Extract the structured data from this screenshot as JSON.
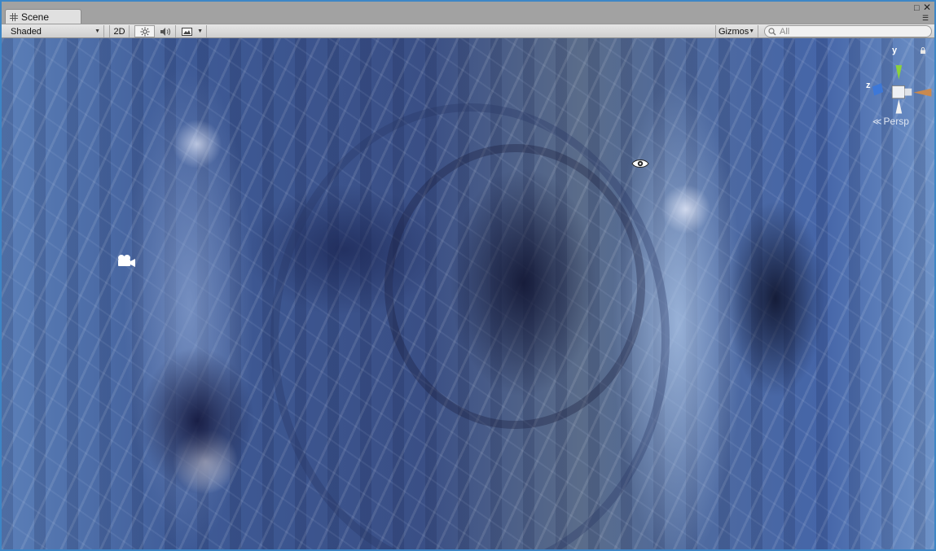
{
  "window": {
    "tab_title": "Scene",
    "tab_icon": "scene-grid-icon",
    "controls": [
      "maximize-icon",
      "close-icon",
      "menu-icon"
    ]
  },
  "toolbar": {
    "shading_mode": "Shaded",
    "mode_2d_label": "2D",
    "lighting_icon": "sun-icon",
    "audio_icon": "speaker-icon",
    "effects_icon": "image-icon",
    "gizmos_label": "Gizmos",
    "search_placeholder": "All"
  },
  "viewport": {
    "gizmo_axis_y": "y",
    "gizmo_axis_z": "z",
    "projection_label": "Persp",
    "colors": {
      "axis_y": "#8bd23c",
      "axis_z": "#3d78d8",
      "axis_x": "#c9894f"
    }
  }
}
